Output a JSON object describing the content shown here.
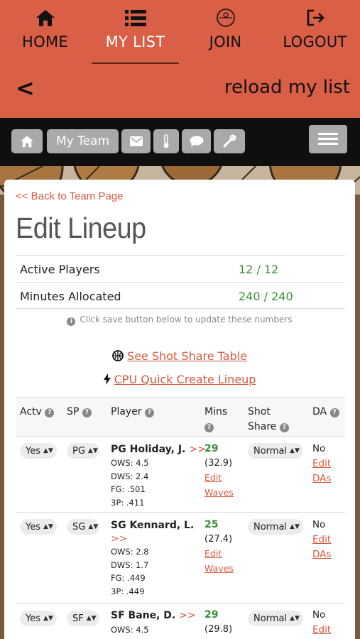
{
  "topnav": {
    "items": [
      {
        "label": "HOME",
        "icon": "home-icon"
      },
      {
        "label": "MY LIST",
        "icon": "list-icon"
      },
      {
        "label": "JOIN",
        "icon": "join-badge-icon"
      },
      {
        "label": "LOGOUT",
        "icon": "logout-icon"
      }
    ],
    "active_index": 1,
    "color": "#d95f46"
  },
  "reloadbar": {
    "back": "<",
    "reload_label": "reload my list"
  },
  "toolbar": {
    "my_team": "My Team",
    "icons": [
      "home-icon",
      "mail-icon",
      "thermometer-icon",
      "chat-icon",
      "tools-icon"
    ]
  },
  "card": {
    "back_link": "<< Back to Team Page",
    "title": "Edit Lineup",
    "stats": [
      {
        "label": "Active Players",
        "value": "12 / 12"
      },
      {
        "label": "Minutes Allocated",
        "value": "240 / 240"
      }
    ],
    "hint": "Click save button below to update these numbers",
    "shot_share_link": "See Shot Share Table",
    "cpu_link": "CPU Quick Create Lineup"
  },
  "table": {
    "headers": {
      "actv": "Actv",
      "sp": "SP",
      "player": "Player",
      "mins": "Mins",
      "shot_share_1": "Shot",
      "shot_share_2": "Share",
      "da": "DA"
    },
    "rows": [
      {
        "actv": "Yes",
        "sp": "PG",
        "name_1": "PG Holiday, J.",
        "name_2": "",
        "arrow": ">>",
        "ows": "OWS: 4.5",
        "dws": "DWS: 2.4",
        "fg": "FG: .501",
        "tp": "3P: .411",
        "mins": "29",
        "mins_sub": "(32.9)",
        "edit_1": "Edit",
        "edit_2": "Waves",
        "shot": "Normal",
        "da": "No",
        "da_edit_1": "Edit",
        "da_edit_2": "DAs"
      },
      {
        "actv": "Yes",
        "sp": "SG",
        "name_1": "SG Kennard, L.",
        "name_2": "",
        "arrow": ">>",
        "ows": "OWS: 2.8",
        "dws": "DWS: 1.7",
        "fg": "FG: .449",
        "tp": "3P: .449",
        "mins": "25",
        "mins_sub": "(27.4)",
        "edit_1": "Edit",
        "edit_2": "Waves",
        "shot": "Normal",
        "da": "No",
        "da_edit_1": "Edit",
        "da_edit_2": "DAs"
      },
      {
        "actv": "Yes",
        "sp": "SF",
        "name_1": "SF Bane, D.",
        "name_2": "",
        "arrow": ">>",
        "ows": "OWS: 4.5",
        "dws": "",
        "fg": "",
        "tp": "",
        "mins": "29",
        "mins_sub": "(29.8)",
        "edit_1": "",
        "edit_2": "",
        "shot": "Normal",
        "da": "No",
        "da_edit_1": "Edit",
        "da_edit_2": ""
      }
    ]
  }
}
